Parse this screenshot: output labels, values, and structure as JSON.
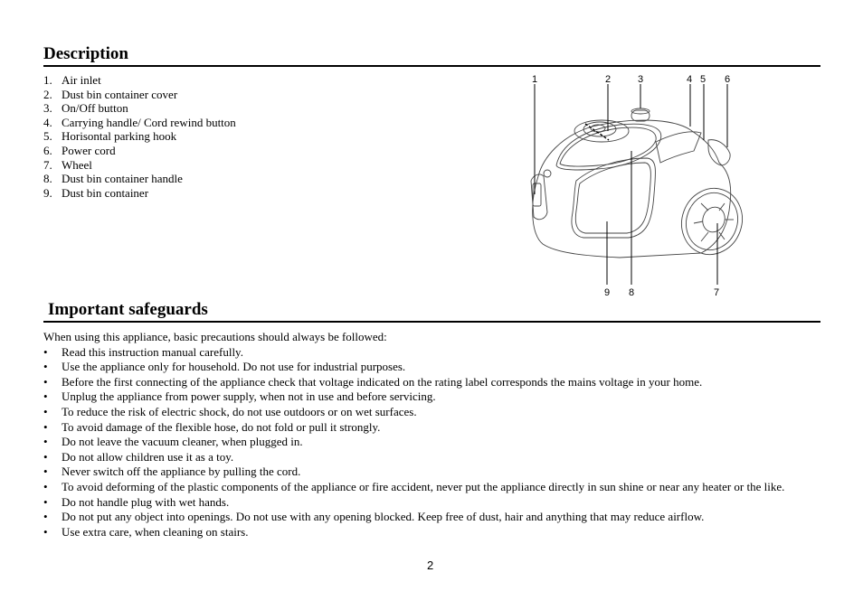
{
  "description": {
    "title": "Description",
    "items": [
      {
        "num": "1.",
        "text": "Air inlet"
      },
      {
        "num": "2.",
        "text": "Dust bin container cover"
      },
      {
        "num": "3.",
        "text": "On/Off button"
      },
      {
        "num": "4.",
        "text": "Carrying handle/ Cord rewind button"
      },
      {
        "num": "5.",
        "text": "Horisontal parking hook"
      },
      {
        "num": "6.",
        "text": "Power cord"
      },
      {
        "num": "7.",
        "text": "Wheel"
      },
      {
        "num": "8.",
        "text": "Dust bin container handle"
      },
      {
        "num": "9.",
        "text": "Dust bin container"
      }
    ]
  },
  "figure": {
    "callouts": [
      "1",
      "2",
      "3",
      "4",
      "5",
      "6",
      "7",
      "8",
      "9"
    ]
  },
  "safeguards": {
    "title": "Important safeguards",
    "intro": "When using this appliance, basic precautions should always be followed:",
    "bullet": "•",
    "items": [
      "Read this instruction manual carefully.",
      "Use the appliance only for household. Do not use for industrial purposes.",
      "Before the first connecting of the appliance check that voltage indicated on the rating label corresponds the mains voltage in your home.",
      "Unplug the appliance from power supply, when not in use and before servicing.",
      "To reduce the risk of electric shock, do not use outdoors or on wet surfaces.",
      "To avoid damage of the flexible hose, do not fold or pull it strongly.",
      "Do not leave the vacuum cleaner, when plugged in.",
      "Do not allow children use it as a toy.",
      "Never switch off the appliance by pulling the cord.",
      "To avoid deforming of the plastic components of the appliance or fire accident, never put the appliance directly in sun shine or near any heater or the like.",
      "Do not handle plug with wet hands.",
      "Do not put any object into openings. Do not use with any opening blocked. Keep free of dust, hair and anything that may reduce airflow.",
      "Use extra care, when cleaning on stairs."
    ]
  },
  "page_number": "2"
}
